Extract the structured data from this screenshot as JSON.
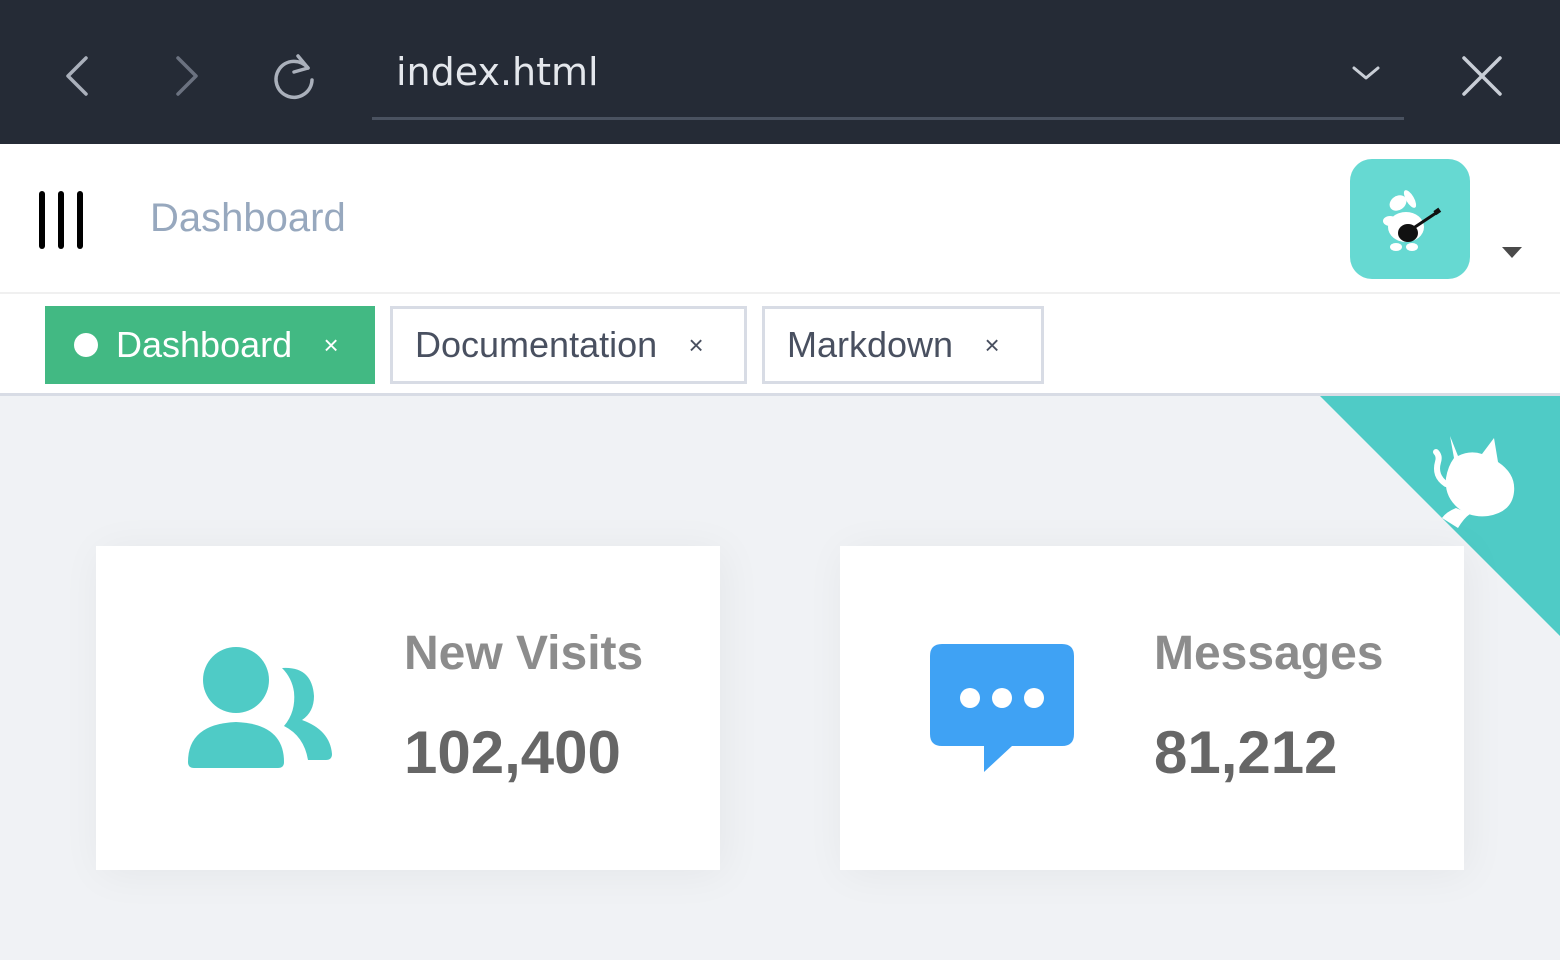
{
  "browser": {
    "address": "index.html"
  },
  "header": {
    "title": "Dashboard"
  },
  "tags": [
    {
      "label": "Dashboard",
      "close": "×",
      "active": true
    },
    {
      "label": "Documentation",
      "close": "×",
      "active": false
    },
    {
      "label": "Markdown",
      "close": "×",
      "active": false
    }
  ],
  "cards": [
    {
      "label": "New Visits",
      "value": "102,400",
      "icon": "peoples-icon",
      "color": "#4fcbc6"
    },
    {
      "label": "Messages",
      "value": "81,212",
      "icon": "message-icon",
      "color": "#3fa2f4"
    }
  ],
  "colors": {
    "browser_bar": "#252b36",
    "active_tag": "#42b983",
    "ribbon": "#4fcbc6",
    "avatar_bg": "#66d9d2"
  }
}
